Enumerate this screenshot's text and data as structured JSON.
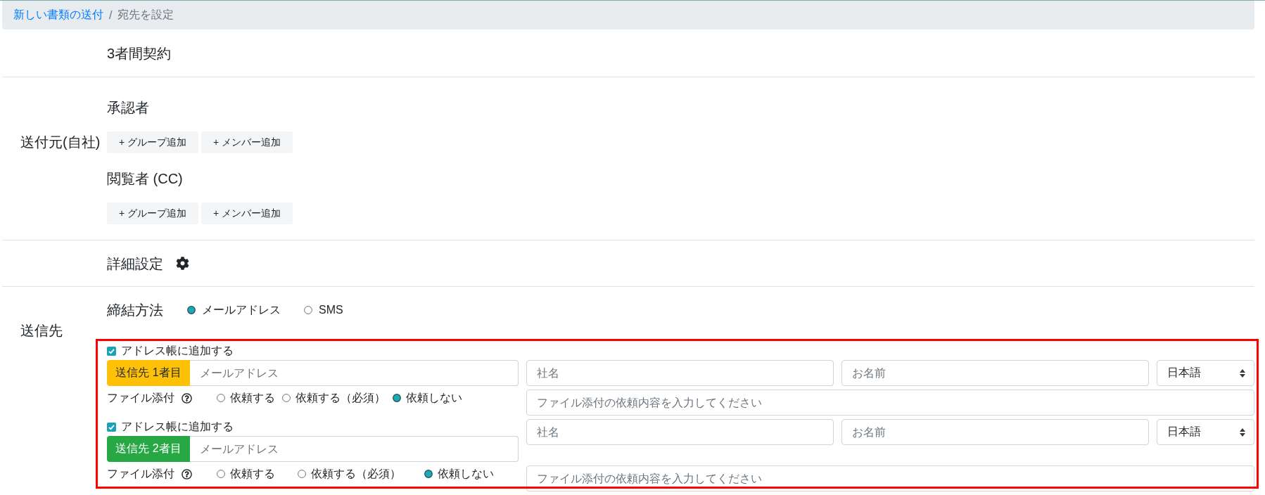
{
  "breadcrumb": {
    "items": [
      {
        "label": "新しい書類の送付",
        "kind": "link"
      },
      {
        "label": "宛先を設定",
        "kind": "current"
      }
    ],
    "separator": "/"
  },
  "contract_type": "3者間契約",
  "sender": {
    "label": "送付元(自社)",
    "groups": [
      {
        "title": "承認者",
        "buttons": [
          "+ グループ追加",
          "+ メンバー追加"
        ]
      },
      {
        "title": "閲覧者 (CC)",
        "buttons": [
          "+ グループ追加",
          "+ メンバー追加"
        ]
      }
    ]
  },
  "advanced_settings": {
    "label": "詳細設定"
  },
  "recipients_section": {
    "label": "送信先",
    "method": {
      "label": "締結方法",
      "options": [
        {
          "label": "メールアドレス",
          "selected": true
        },
        {
          "label": "SMS",
          "selected": false
        }
      ]
    },
    "recipients": [
      {
        "address_book": {
          "label": "アドレス帳に追加する",
          "checked": true
        },
        "badge": {
          "label": "送信先 1者目",
          "color": "#ffc107"
        },
        "email": {
          "placeholder": "メールアドレス"
        },
        "company": {
          "placeholder": "社名"
        },
        "name": {
          "placeholder": "お名前"
        },
        "language": {
          "value": "日本語"
        },
        "file_attachment": {
          "label": "ファイル添付",
          "options": [
            {
              "label": "依頼する",
              "selected": false
            },
            {
              "label": "依頼する（必須）",
              "selected": false
            },
            {
              "label": "依頼しない",
              "selected": true
            }
          ]
        },
        "request_note": {
          "placeholder": "ファイル添付の依頼内容を入力してください"
        }
      },
      {
        "address_book": {
          "label": "アドレス帳に追加する",
          "checked": true
        },
        "badge": {
          "label": "送信先 2者目",
          "color": "#28a745"
        },
        "email": {
          "placeholder": "メールアドレス"
        },
        "company": {
          "placeholder": "社名"
        },
        "name": {
          "placeholder": "お名前"
        },
        "language": {
          "value": "日本語"
        },
        "file_attachment": {
          "label": "ファイル添付",
          "options": [
            {
              "label": "依頼する",
              "selected": false
            },
            {
              "label": "依頼する（必須）",
              "selected": false
            },
            {
              "label": "依頼しない",
              "selected": true
            }
          ]
        },
        "request_note": {
          "placeholder": "ファイル添付の依頼内容を入力してください"
        }
      }
    ]
  }
}
